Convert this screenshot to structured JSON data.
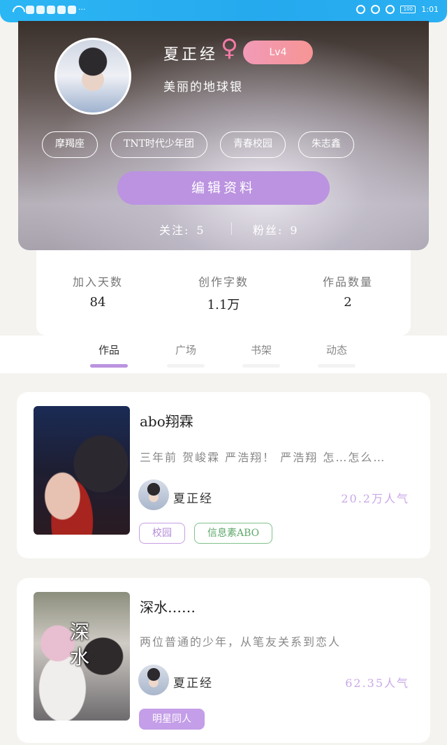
{
  "status_bar": {
    "overflow": "···",
    "time": "1:01",
    "battery": "100"
  },
  "profile": {
    "name": "夏正经",
    "gender_symbol": "♀",
    "level": "Lv4",
    "motto": "美丽的地球银",
    "tags": [
      "摩羯座",
      "TNT时代少年团",
      "青春校园",
      "朱志鑫"
    ],
    "edit_button": "编辑资料",
    "following_label": "关注:",
    "following_count": "5",
    "fans_label": "粉丝:",
    "fans_count": "9"
  },
  "stats": [
    {
      "label": "加入天数",
      "value": "84"
    },
    {
      "label": "创作字数",
      "value": "1.1万"
    },
    {
      "label": "作品数量",
      "value": "2"
    }
  ],
  "tabs": [
    {
      "label": "作品",
      "active": true
    },
    {
      "label": "广场",
      "active": false
    },
    {
      "label": "书架",
      "active": false
    },
    {
      "label": "动态",
      "active": false
    }
  ],
  "works": [
    {
      "title": "abo翔霖",
      "description": "三年前 贺峻霖 严浩翔！ 严浩翔 怎…怎么…",
      "author": "夏正经",
      "popularity": "20.2万人气",
      "tags": [
        "校园",
        "信息素ABO"
      ]
    },
    {
      "title": "深水……",
      "description": "两位普通的少年，从笔友关系到恋人",
      "author": "夏正经",
      "popularity": "62.35人气",
      "tags": [
        "明星同人"
      ],
      "cover_text": "深 水"
    }
  ],
  "colors": {
    "accent": "#bb93e0",
    "gender": "#f37aa6",
    "level_badge": "#f29ab8",
    "statusbar": "#2bb6f4",
    "tag_green": "#7fc28a"
  }
}
